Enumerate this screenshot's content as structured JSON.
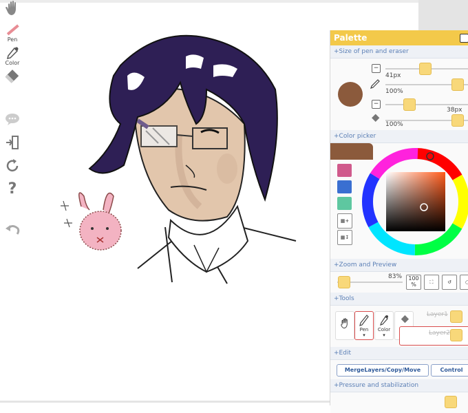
{
  "toolbar": {
    "tools": [
      {
        "name": "hand",
        "label": ""
      },
      {
        "name": "pen",
        "label": "Pen"
      },
      {
        "name": "color",
        "label": "Color"
      },
      {
        "name": "eraser",
        "label": ""
      },
      {
        "name": "comment",
        "label": ""
      },
      {
        "name": "exit",
        "label": ""
      },
      {
        "name": "reload",
        "label": ""
      },
      {
        "name": "help",
        "label": "?"
      },
      {
        "name": "undo",
        "label": ""
      }
    ]
  },
  "palette": {
    "title": "Palette",
    "sections": {
      "size": "+Size of pen and eraser",
      "color_picker": "+Color picker",
      "zoom": "+Zoom and Preview",
      "tools": "+Tools",
      "edit": "+Edit",
      "pressure": "+Pressure and stabilization"
    },
    "pen": {
      "size": "41px",
      "opacity": "100%",
      "size_level": 0.39,
      "opacity_level": 1.0
    },
    "eraser": {
      "size": "38px",
      "opacity": "100%",
      "size_level": 0.36,
      "opacity_level": 1.0
    },
    "current_color": "#8b5a3c",
    "swatches": [
      "#d05a8c",
      "#3a6fd1",
      "#5ec7a0"
    ],
    "zoom": {
      "value": "83%",
      "level": 0.06,
      "reset_label": "100\n%"
    },
    "tools": {
      "pen": "Pen",
      "color": "Color"
    },
    "layers": [
      "Layer1",
      "Layer2"
    ],
    "edit": {
      "merge": "MergeLayers/Copy/Move",
      "control": "Control"
    }
  },
  "colors": {
    "header": "#f3c94a",
    "section_text": "#5b7fb5",
    "hair": "#2e1f55",
    "skin": "#e2c6ac"
  }
}
